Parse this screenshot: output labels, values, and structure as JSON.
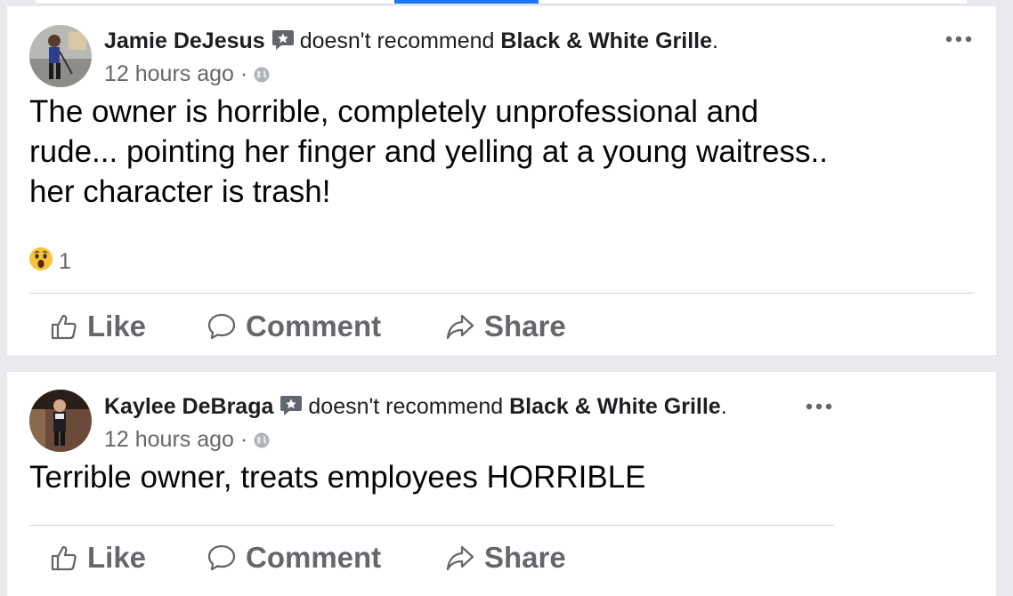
{
  "posts": [
    {
      "author": "Jamie DeJesus",
      "verb": "doesn't recommend",
      "page": "Black & White Grille",
      "time": "12 hours ago",
      "separator": "·",
      "text": "The owner is horrible, completely unprofessional and rude... pointing her finger and yelling at a young waitress.. her character is trash!",
      "reaction_count": "1",
      "reaction_icon": "wow-icon",
      "actions": {
        "like": "Like",
        "comment": "Comment",
        "share": "Share"
      }
    },
    {
      "author": "Kaylee DeBraga",
      "verb": "doesn't recommend",
      "page": "Black & White Grille",
      "time": "12 hours ago",
      "separator": "·",
      "text": "Terrible owner, treats employees HORRIBLE",
      "actions": {
        "like": "Like",
        "comment": "Comment",
        "share": "Share"
      }
    }
  ],
  "colors": {
    "accent": "#1877f2",
    "secondary_text": "#65676b",
    "background": "#e9eaed"
  }
}
